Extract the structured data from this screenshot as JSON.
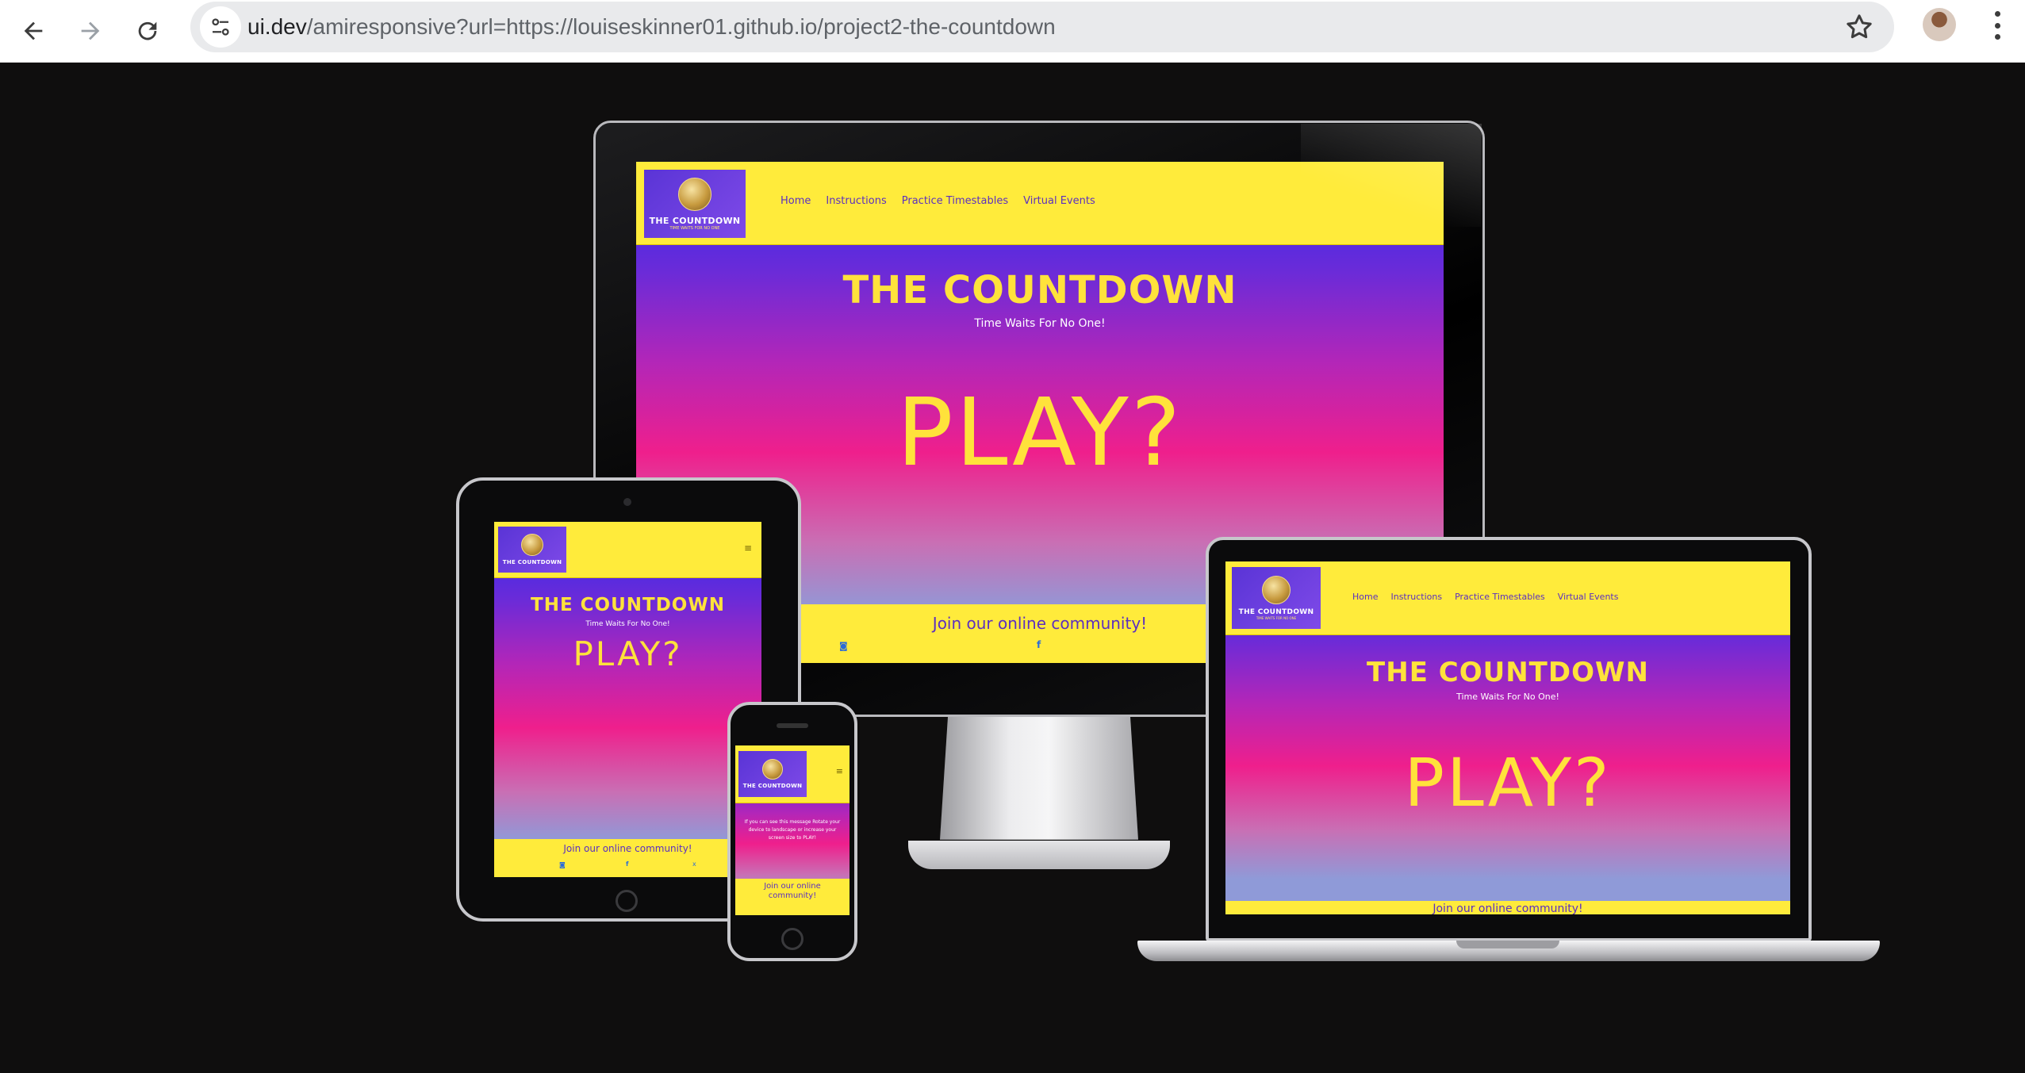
{
  "browser": {
    "url_host": "ui.dev",
    "url_path": "/amiresponsive?url=https://louiseskinner01.github.io/project2-the-countdown",
    "icons": [
      "back-arrow-icon",
      "forward-arrow-icon",
      "reload-icon",
      "site-info-icon",
      "bookmark-star-icon",
      "profile-avatar",
      "kebab-menu-icon"
    ]
  },
  "site": {
    "logo_title": "THE COUNTDOWN",
    "logo_sub": "TIME WAITS FOR NO ONE",
    "nav": [
      "Home",
      "Instructions",
      "Practice Timestables",
      "Virtual Events"
    ],
    "title": "THE COUNTDOWN",
    "tagline": "Time Waits For No One!",
    "play": "PLAY?",
    "community": "Join our online community!",
    "phone_message": "If you can see this message Rotate your device to landscape or increase your screen size to PLAY!",
    "phone_community": "Join our online community!",
    "colors": {
      "header": "#ffeb3b",
      "title": "#ffe23b",
      "link": "#5b2fc0",
      "grad_top": "#2a2bf0",
      "grad_mid": "#ef1f8c"
    }
  }
}
